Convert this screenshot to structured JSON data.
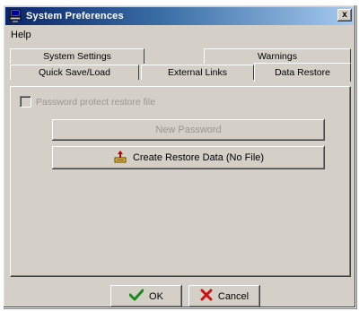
{
  "window": {
    "title": "System Preferences",
    "close_label": "x"
  },
  "menu": {
    "items": [
      {
        "label": "Help"
      }
    ]
  },
  "tabs": {
    "row1": [
      {
        "label": "System Settings"
      },
      {
        "label": "Warnings"
      }
    ],
    "row2": [
      {
        "label": "Quick Save/Load"
      },
      {
        "label": "External Links"
      },
      {
        "label": "Data Restore",
        "active": true
      }
    ]
  },
  "panel": {
    "password_checkbox": {
      "label": "Password protect restore file",
      "checked": false,
      "enabled": false
    },
    "new_password_label": "New Password",
    "create_restore_label": "Create Restore Data (No File)"
  },
  "footer": {
    "ok_label": "OK",
    "cancel_label": "Cancel"
  },
  "colors": {
    "title_start": "#0a246a",
    "title_end": "#a6caf0",
    "face": "#d4d0c8",
    "disabled_text": "#9a968c",
    "ok_check": "#1a8a1a",
    "cancel_x": "#d01010"
  }
}
